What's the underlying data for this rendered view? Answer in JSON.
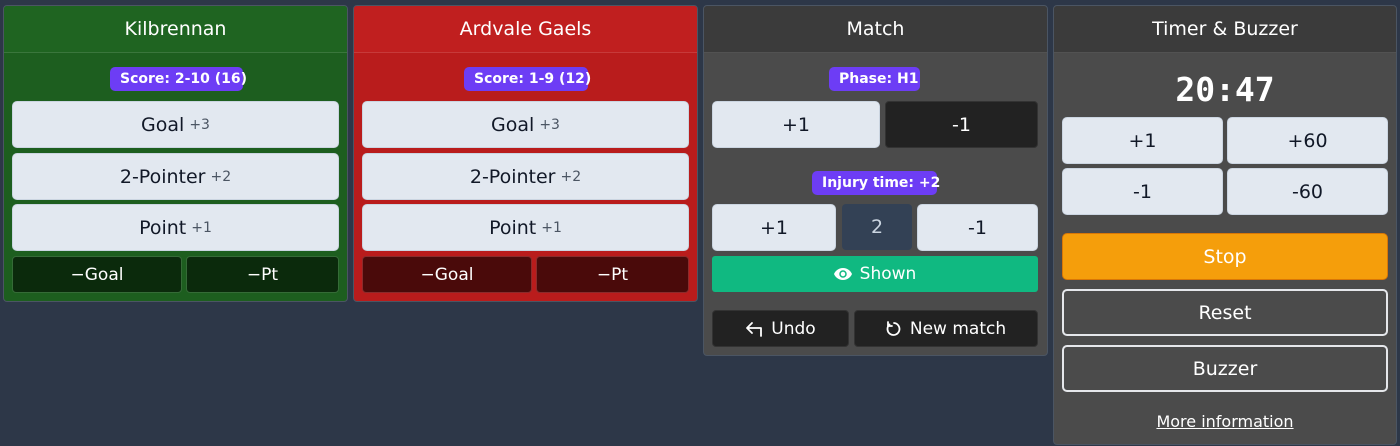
{
  "teams": [
    {
      "name": "Kilbrennan",
      "score": "Score: 2-10 (16)",
      "goal_label": "Goal",
      "goal_pts": "+3",
      "two_pointer_label": "2-Pointer",
      "two_pointer_pts": "+2",
      "point_label": "Point",
      "point_pts": "+1",
      "minus_goal": "−Goal",
      "minus_pt": "−Pt",
      "color": "#1d5e1f"
    },
    {
      "name": "Ardvale Gaels",
      "score": "Score: 1-9 (12)",
      "goal_label": "Goal",
      "goal_pts": "+3",
      "two_pointer_label": "2-Pointer",
      "two_pointer_pts": "+2",
      "point_label": "Point",
      "point_pts": "+1",
      "minus_goal": "−Goal",
      "minus_pt": "−Pt",
      "color": "#b91c1c"
    }
  ],
  "match": {
    "title": "Match",
    "phase": "Phase: H1",
    "phase_plus": "+1",
    "phase_minus": "-1",
    "injury": "Injury time: +2",
    "injury_plus": "+1",
    "injury_value": "2",
    "injury_minus": "-1",
    "shown": "Shown",
    "undo": "Undo",
    "new_match": "New match",
    "icons": {
      "shown": "eye-icon",
      "undo": "undo-arrow-icon",
      "new_match": "rotate-icon"
    }
  },
  "timer": {
    "title": "Timer & Buzzer",
    "clock": "20:47",
    "plus1": "+1",
    "plus60": "+60",
    "minus1": "-1",
    "minus60": "-60",
    "stop": "Stop",
    "reset": "Reset",
    "buzzer": "Buzzer",
    "more_info": "More information"
  },
  "colors": {
    "accent_badge": "#6d3df5",
    "shown_green": "#10b981",
    "stop_orange": "#f59e0b"
  }
}
